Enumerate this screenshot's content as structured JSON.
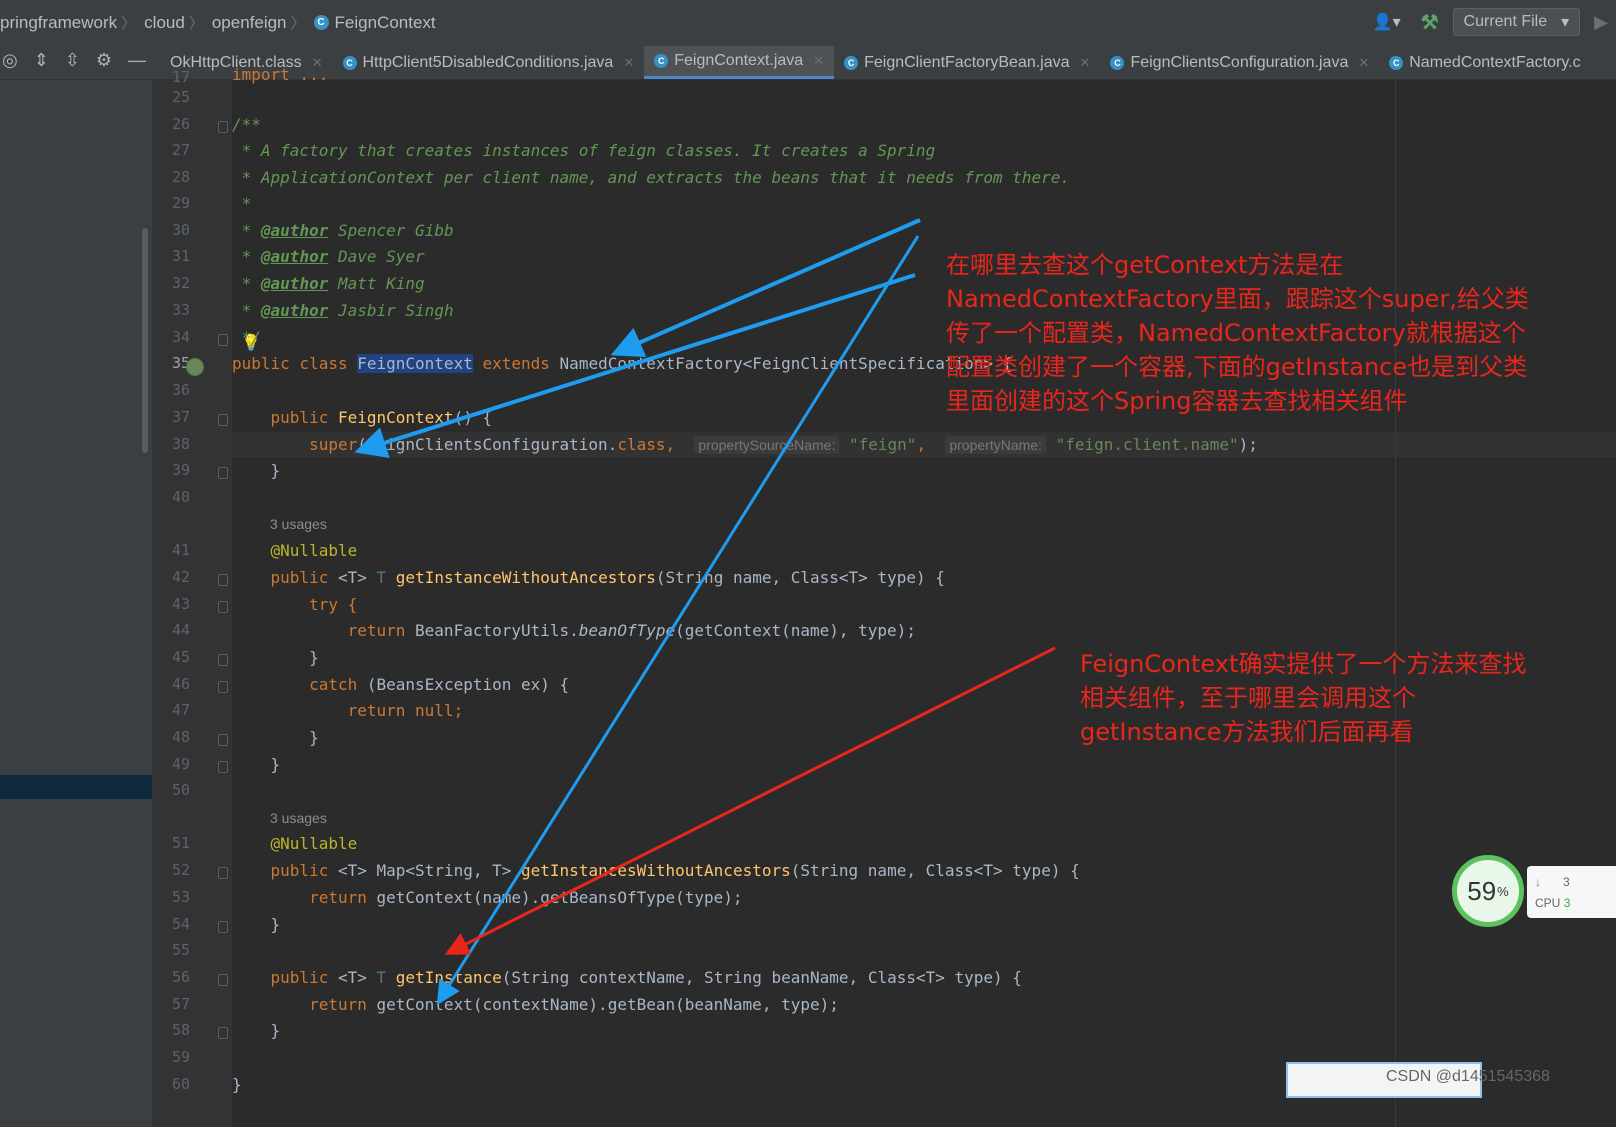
{
  "breadcrumb": {
    "items": [
      "pringframework",
      "cloud",
      "openfeign",
      "FeignContext"
    ]
  },
  "toolbar": {
    "run_config": "Current File"
  },
  "tabs": [
    {
      "label": "OkHttpClient.class",
      "active": false
    },
    {
      "label": "HttpClient5DisabledConditions.java",
      "active": false
    },
    {
      "label": "FeignContext.java",
      "active": true
    },
    {
      "label": "FeignClientFactoryBean.java",
      "active": false
    },
    {
      "label": "FeignClientsConfiguration.java",
      "active": false
    },
    {
      "label": "NamedContextFactory.c",
      "active": false
    }
  ],
  "gutter": {
    "line_numbers": [
      "17",
      "25",
      "26",
      "27",
      "28",
      "29",
      "30",
      "31",
      "32",
      "33",
      "34",
      "35",
      "36",
      "37",
      "38",
      "39",
      "40",
      "41",
      "42",
      "43",
      "44",
      "45",
      "46",
      "47",
      "48",
      "49",
      "50",
      "51",
      "52",
      "53",
      "54",
      "55",
      "56",
      "57",
      "58",
      "59",
      "60"
    ],
    "current_line": "35"
  },
  "code": {
    "collapsed_import": "import ...",
    "javadoc_open": "/**",
    "javadoc_line1": " * A factory that creates instances of feign classes. It creates a Spring",
    "javadoc_line2": " * ApplicationContext per client name, and extracts the beans that it needs from there.",
    "javadoc_blank": " *",
    "author_tag": "@author",
    "authors": [
      "Spencer Gibb",
      "Dave Syer",
      "Matt King",
      "Jasbir Singh"
    ],
    "javadoc_close": " */",
    "class_decl": {
      "mod": "public class",
      "name": "FeignContext",
      "ext": "extends",
      "parent": "NamedContextFactory<FeignClientSpecification>",
      "brace": "{"
    },
    "ctor_decl": {
      "mod": "public",
      "name": "FeignContext",
      "rest": "() {"
    },
    "super_call": {
      "kw": "super",
      "arg1": "(FeignClientsConfiguration.",
      "cls": "class",
      "hint1": "propertySourceName:",
      "str1": "\"feign\"",
      "hint2": "propertyName:",
      "str2": "\"feign.client.name\"",
      "end": ");"
    },
    "close_brace": "}",
    "usages": "3 usages",
    "nullable": "@Nullable",
    "m1_decl": {
      "mod": "public",
      "gen": "<T>",
      "ret": "T",
      "name": "getInstanceWithoutAncestors",
      "params": "(String name, Class<T> type) {"
    },
    "try_line": "try {",
    "return_bf": {
      "kw": "return",
      "cls": "BeanFactoryUtils.",
      "call": "beanOfType",
      "rest": "(getContext(name), type);"
    },
    "catch_line": {
      "kw": "catch",
      "rest": "(BeansException ex) {"
    },
    "return_null": {
      "kw": "return",
      "val": "null;"
    },
    "m2_decl": {
      "mod": "public",
      "gen": "<T>",
      "ret": "Map<String, T>",
      "name": "getInstancesWithoutAncestors",
      "params": "(String name, Class<T> type) {"
    },
    "m2_body": {
      "kw": "return",
      "rest": "getContext(name).getBeansOfType(type);"
    },
    "m3_decl": {
      "mod": "public",
      "gen": "<T>",
      "ret": "T",
      "name": "getInstance",
      "params": "(String contextName, String beanName, Class<T> type) {"
    },
    "m3_body": {
      "kw": "return",
      "rest": "getContext(contextName).getBean(beanName, type);"
    }
  },
  "annotations": {
    "note1": [
      "在哪里去查这个getContext方法是在",
      "NamedContextFactory里面，跟踪这个super,给父类",
      "传了一个配置类，NamedContextFactory就根据这个",
      "配置类创建了一个容器,下面的getInstance也是到父类",
      "里面创建的这个Spring容器去查找相关组件"
    ],
    "note2": [
      "FeignContext确实提供了一个方法来查找",
      "相关组件，至于哪里会调用这个",
      "getInstance方法我们后面再看"
    ]
  },
  "widgets": {
    "cpu_percent": "59",
    "cpu_percent_unit": "%",
    "cpu_label": "CPU",
    "cpu_value_cut": "3",
    "cpu_down_value": "3",
    "watermark": "CSDN @d1451545368"
  },
  "colors": {
    "background": "#2b2b2b",
    "keyword": "#cc7832",
    "comment": "#629755",
    "method": "#ffc66d",
    "annotation": "#bbb529",
    "string": "#6a8759",
    "arrow_blue": "#1e9cf0",
    "arrow_red": "#e8261c"
  }
}
